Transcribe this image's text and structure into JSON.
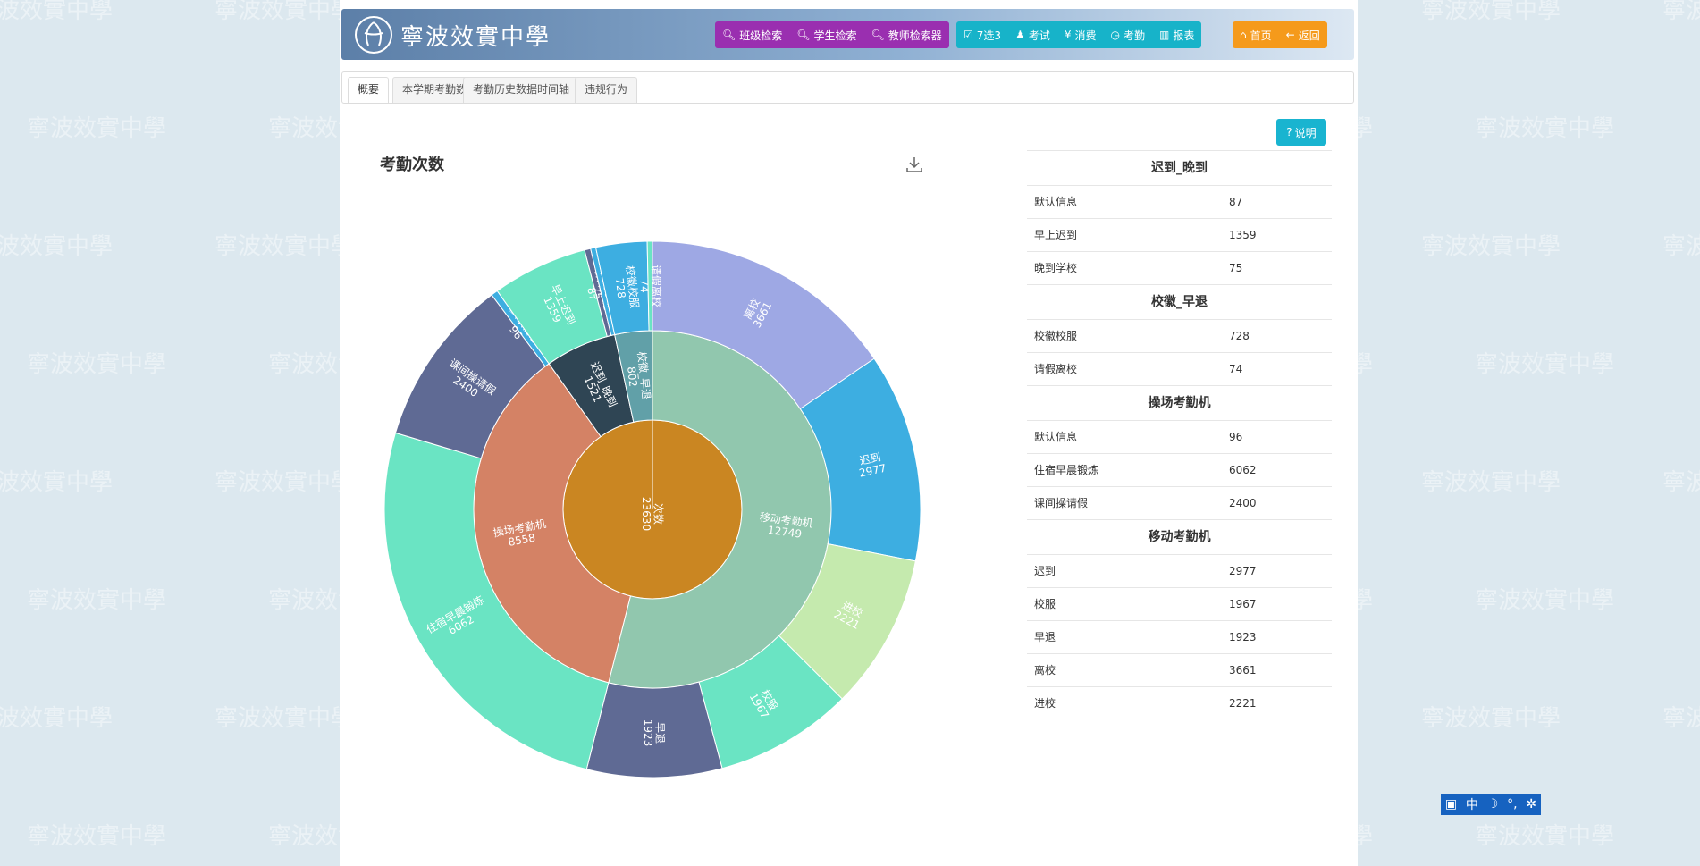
{
  "school": {
    "logo_text": "寧波效實中學",
    "watermark_text": "寧波效實中學"
  },
  "header": {
    "search_group": [
      {
        "label": "班级检索",
        "icon": "search-icon"
      },
      {
        "label": "学生检索",
        "icon": "search-icon"
      },
      {
        "label": "教师检索器",
        "icon": "search-icon"
      }
    ],
    "module_group": [
      {
        "label": "7选3",
        "icon": "checkbox-icon"
      },
      {
        "label": "考试",
        "icon": "exam-icon"
      },
      {
        "label": "消费",
        "icon": "yen-icon"
      },
      {
        "label": "考勤",
        "icon": "clock-icon"
      },
      {
        "label": "报表",
        "icon": "bar-chart-icon"
      }
    ],
    "nav_group": [
      {
        "label": "首页",
        "icon": "home-icon"
      },
      {
        "label": "返回",
        "icon": "arrow-left-icon"
      }
    ]
  },
  "tabs": [
    {
      "label": "概要",
      "active": true
    },
    {
      "label": "本学期考勤数据",
      "active": false
    },
    {
      "label": "考勤历史数据时间轴",
      "active": false
    },
    {
      "label": "违规行为",
      "active": false
    }
  ],
  "help_button": {
    "label": "说明"
  },
  "chart_data": {
    "type": "sunburst",
    "title": "考勤次数",
    "root": {
      "name": "次数",
      "value": 23630
    },
    "groups": [
      {
        "name": "移动考勤机",
        "value": 12749,
        "color": "#91c7ae",
        "children": [
          {
            "name": "离校",
            "value": 3661,
            "color": "#9ea8e4"
          },
          {
            "name": "迟到",
            "value": 2977,
            "color": "#3daee1"
          },
          {
            "name": "进校",
            "value": 2221,
            "color": "#c5eaae"
          },
          {
            "name": "校服",
            "value": 1967,
            "color": "#6ae4c3"
          },
          {
            "name": "早退",
            "value": 1923,
            "color": "#5f6a94"
          }
        ]
      },
      {
        "name": "操场考勤机",
        "value": 8558,
        "color": "#d48265",
        "children": [
          {
            "name": "住宿早晨锻炼",
            "value": 6062,
            "color": "#6ae4c3"
          },
          {
            "name": "课间操请假",
            "value": 2400,
            "color": "#5f6a94"
          },
          {
            "name": "默认信息",
            "value": 96,
            "color": "#3daee1"
          }
        ]
      },
      {
        "name": "迟到_晚到",
        "value": 1521,
        "color": "#2f4554",
        "children": [
          {
            "name": "早上迟到",
            "value": 1359,
            "color": "#6ae4c3"
          },
          {
            "name": "默认信息",
            "value": 87,
            "color": "#5f6a94"
          },
          {
            "name": "晚到学校",
            "value": 75,
            "color": "#3daee1"
          }
        ]
      },
      {
        "name": "校徽_早退",
        "value": 802,
        "color": "#61a0a8",
        "children": [
          {
            "name": "校徽校服",
            "value": 728,
            "color": "#3daee1"
          },
          {
            "name": "请假离校",
            "value": 74,
            "color": "#6ae4c3"
          }
        ]
      }
    ],
    "root_color": "#ca8622"
  },
  "table": {
    "sections": [
      {
        "title": "迟到_晚到",
        "rows": [
          {
            "label": "默认信息",
            "value": "87"
          },
          {
            "label": "早上迟到",
            "value": "1359"
          },
          {
            "label": "晚到学校",
            "value": "75"
          }
        ]
      },
      {
        "title": "校徽_早退",
        "rows": [
          {
            "label": "校徽校服",
            "value": "728"
          },
          {
            "label": "请假离校",
            "value": "74"
          }
        ]
      },
      {
        "title": "操场考勤机",
        "rows": [
          {
            "label": "默认信息",
            "value": "96"
          },
          {
            "label": "住宿早晨锻炼",
            "value": "6062"
          },
          {
            "label": "课间操请假",
            "value": "2400"
          }
        ]
      },
      {
        "title": "移动考勤机",
        "rows": [
          {
            "label": "迟到",
            "value": "2977"
          },
          {
            "label": "校服",
            "value": "1967"
          },
          {
            "label": "早退",
            "value": "1923"
          },
          {
            "label": "离校",
            "value": "3661"
          },
          {
            "label": "进校",
            "value": "2221"
          }
        ]
      }
    ]
  },
  "ime_bar": {
    "lang": "中"
  }
}
